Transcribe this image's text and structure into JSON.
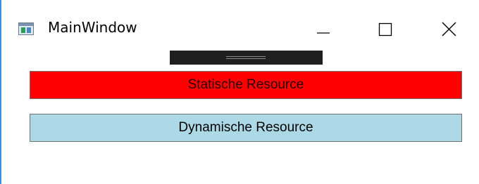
{
  "window": {
    "title": "MainWindow",
    "icon": "app-window-icon",
    "controls": {
      "minimize_icon": "minimize-icon",
      "maximize_icon": "maximize-icon",
      "close_icon": "close-icon"
    }
  },
  "content": {
    "buttons": [
      {
        "label": "Statische Resource",
        "background": "#ff0000"
      },
      {
        "label": "Dynamische Resource",
        "background": "#add8e6"
      }
    ],
    "splitter_color": "#1f1f1f"
  }
}
